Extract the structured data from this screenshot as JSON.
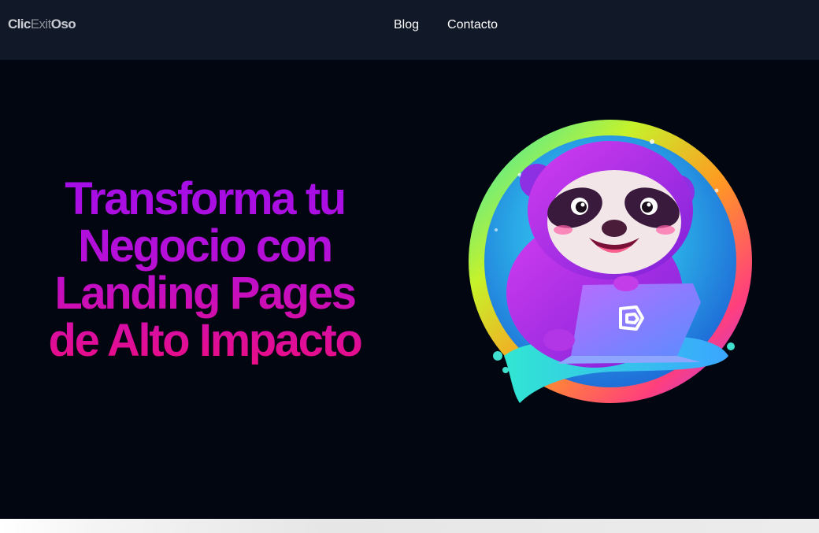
{
  "header": {
    "logo": {
      "part1": "Clic",
      "part2": "Exit",
      "part3": "Oso"
    },
    "nav": [
      {
        "label": "Blog"
      },
      {
        "label": "Contacto"
      }
    ]
  },
  "hero": {
    "headline_lines": [
      "Transforma tu",
      "Negocio con",
      "Landing Pages",
      "de Alto Impacto"
    ],
    "mascot": "sloth-with-laptop-illustration"
  },
  "colors": {
    "header_bg": "#111827",
    "page_bg": "#020611",
    "headline_gradient_top": "#a30ee8",
    "headline_gradient_bottom": "#ea0d86"
  }
}
